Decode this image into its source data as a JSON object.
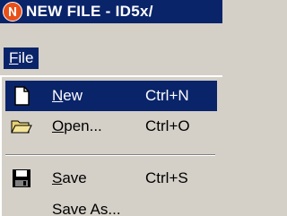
{
  "window": {
    "title": "NEW FILE - ID5x/"
  },
  "menubar": {
    "file_label": "File"
  },
  "file_menu": {
    "items": [
      {
        "label": "New",
        "shortcut": "Ctrl+N",
        "icon": "new-document-icon",
        "selected": true
      },
      {
        "label": "Open...",
        "shortcut": "Ctrl+O",
        "icon": "open-folder-icon",
        "selected": false
      },
      {
        "label": "Save",
        "shortcut": "Ctrl+S",
        "icon": "floppy-disk-icon",
        "selected": false
      },
      {
        "label": "Save As...",
        "shortcut": "",
        "icon": "",
        "selected": false
      }
    ]
  },
  "colors": {
    "titlebar": "#0a246a",
    "highlight": "#0a246a",
    "face": "#d4d0c8",
    "app_icon": "#e8501a"
  }
}
